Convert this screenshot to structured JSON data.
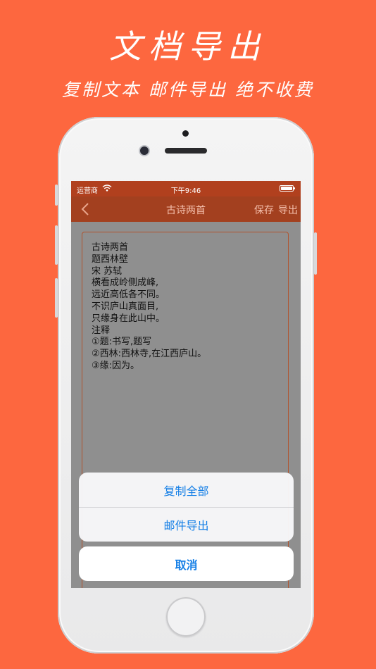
{
  "promo": {
    "title": "文档导出",
    "subtitle": "复制文本 邮件导出 绝不收费"
  },
  "status_bar": {
    "carrier": "运营商",
    "time": "下午9:46"
  },
  "nav": {
    "title": "古诗两首",
    "save_label": "保存",
    "export_label": "导出"
  },
  "document": {
    "lines": [
      "古诗两首",
      "题西林壁",
      "宋 苏轼",
      "横看成岭侧成峰,",
      "远近高低各不同。",
      "不识庐山真面目,",
      "只缘身在此山中。",
      "注释",
      "①题:书写,题写",
      "②西林:西林寺,在江西庐山。",
      "③缘:因为。"
    ]
  },
  "action_sheet": {
    "copy_all_label": "复制全部",
    "email_export_label": "邮件导出",
    "cancel_label": "取消"
  },
  "colors": {
    "background": "#fd673f",
    "nav_bar": "#a3401f",
    "action_text": "#137ee6"
  }
}
